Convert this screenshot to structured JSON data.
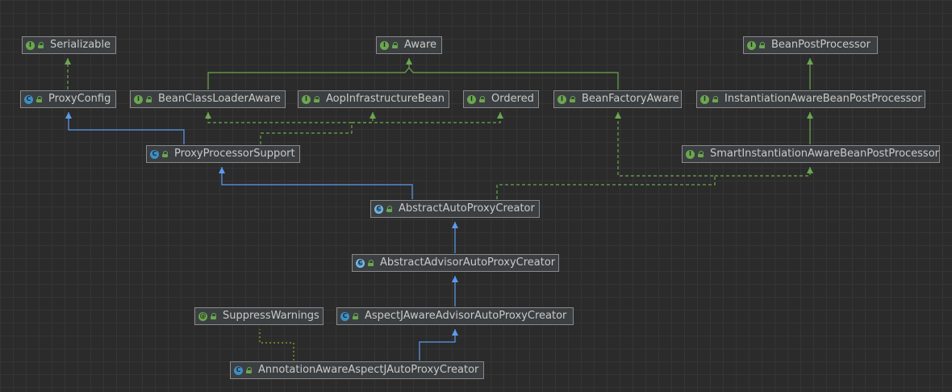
{
  "nodes": {
    "serializable": {
      "name": "Serializable",
      "kind": "interface",
      "kind_letter": "I"
    },
    "aware": {
      "name": "Aware",
      "kind": "interface",
      "kind_letter": "I"
    },
    "bean_post_processor": {
      "name": "BeanPostProcessor",
      "kind": "interface",
      "kind_letter": "I"
    },
    "proxy_config": {
      "name": "ProxyConfig",
      "kind": "class",
      "kind_letter": "C"
    },
    "bean_class_loader_aware": {
      "name": "BeanClassLoaderAware",
      "kind": "interface",
      "kind_letter": "I"
    },
    "aop_infrastructure_bean": {
      "name": "AopInfrastructureBean",
      "kind": "interface",
      "kind_letter": "I"
    },
    "ordered": {
      "name": "Ordered",
      "kind": "interface",
      "kind_letter": "I"
    },
    "bean_factory_aware": {
      "name": "BeanFactoryAware",
      "kind": "interface",
      "kind_letter": "I"
    },
    "instantiation_aware_bpp": {
      "name": "InstantiationAwareBeanPostProcessor",
      "kind": "interface",
      "kind_letter": "I"
    },
    "proxy_processor_support": {
      "name": "ProxyProcessorSupport",
      "kind": "class",
      "kind_letter": "C"
    },
    "smart_instantiation_aware_bpp": {
      "name": "SmartInstantiationAwareBeanPostProcessor",
      "kind": "interface",
      "kind_letter": "I"
    },
    "abstract_auto_proxy_creator": {
      "name": "AbstractAutoProxyCreator",
      "kind": "abstract",
      "kind_letter": "C"
    },
    "abstract_advisor_auto_proxy_creator": {
      "name": "AbstractAdvisorAutoProxyCreator",
      "kind": "abstract",
      "kind_letter": "C"
    },
    "suppress_warnings": {
      "name": "SuppressWarnings",
      "kind": "annotation",
      "kind_letter": "@"
    },
    "aspectj_aware_advisor_auto_proxy_creator": {
      "name": "AspectJAwareAdvisorAutoProxyCreator",
      "kind": "class",
      "kind_letter": "C"
    },
    "annotation_aware_aspectj_auto_proxy_creator": {
      "name": "AnnotationAwareAspectJAutoProxyCreator",
      "kind": "class",
      "kind_letter": "C"
    }
  },
  "colors": {
    "background": "#2b2b2b",
    "grid": "#353535",
    "node_fill": "#3c3f41",
    "node_border": "#8a8a8a",
    "node_text": "#c9c9c9",
    "extends_edge": "#5b9bf0",
    "interface_extends_edge": "#6aa84f",
    "implements_edge": "#6aa84f",
    "annotation_edge": "#9aab2e"
  }
}
